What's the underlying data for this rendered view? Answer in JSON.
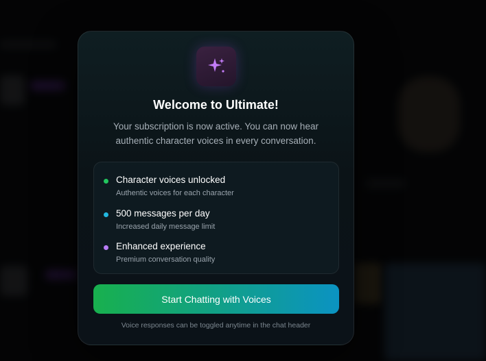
{
  "modal": {
    "icon": "sparkle-icon",
    "title": "Welcome to Ultimate!",
    "subtitle_line1": "Your subscription is now active. You can now hear",
    "subtitle_line2": "authentic character voices in every conversation.",
    "features": [
      {
        "title": "Character voices unlocked",
        "subtitle": "Authentic voices for each character",
        "dot_color": "#22c55e"
      },
      {
        "title": "500 messages per day",
        "subtitle": "Increased daily message limit",
        "dot_color": "#22b8e0"
      },
      {
        "title": "Enhanced experience",
        "subtitle": "Premium conversation quality",
        "dot_color": "#b77cf5"
      }
    ],
    "cta_label": "Start Chatting with Voices",
    "footnote": "Voice responses can be toggled anytime in the chat header"
  },
  "colors": {
    "accent_purple": "#c27cf7",
    "cta_gradient_start": "#18b04e",
    "cta_gradient_end": "#0b93c2"
  }
}
